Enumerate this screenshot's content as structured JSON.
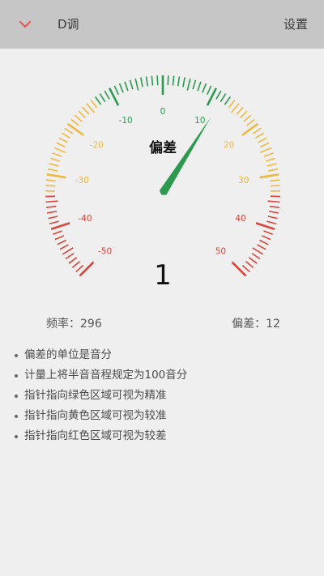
{
  "header": {
    "tuning": "D调",
    "settings_label": "设置",
    "dropdown_icon": "chevron-down-icon",
    "accent_color": "#e8584f"
  },
  "gauge": {
    "center_title": "偏差",
    "value_display": "1",
    "needle_cents": 12,
    "scale_labels": [
      "-50",
      "-40",
      "-30",
      "-20",
      "-10",
      "0",
      "10",
      "20",
      "30",
      "40",
      "50"
    ],
    "zones": {
      "green": "#2b9a4e",
      "yellow": "#f0b840",
      "red": "#d9453a"
    }
  },
  "stats": {
    "frequency": "频率：296",
    "deviation": "偏差：12"
  },
  "notes": [
    "偏差的单位是音分",
    "计量上将半音音程规定为100音分",
    "指针指向绿色区域可视为精准",
    "指针指向黄色区域可视为较准",
    "指针指向红色区域可视为较差"
  ]
}
